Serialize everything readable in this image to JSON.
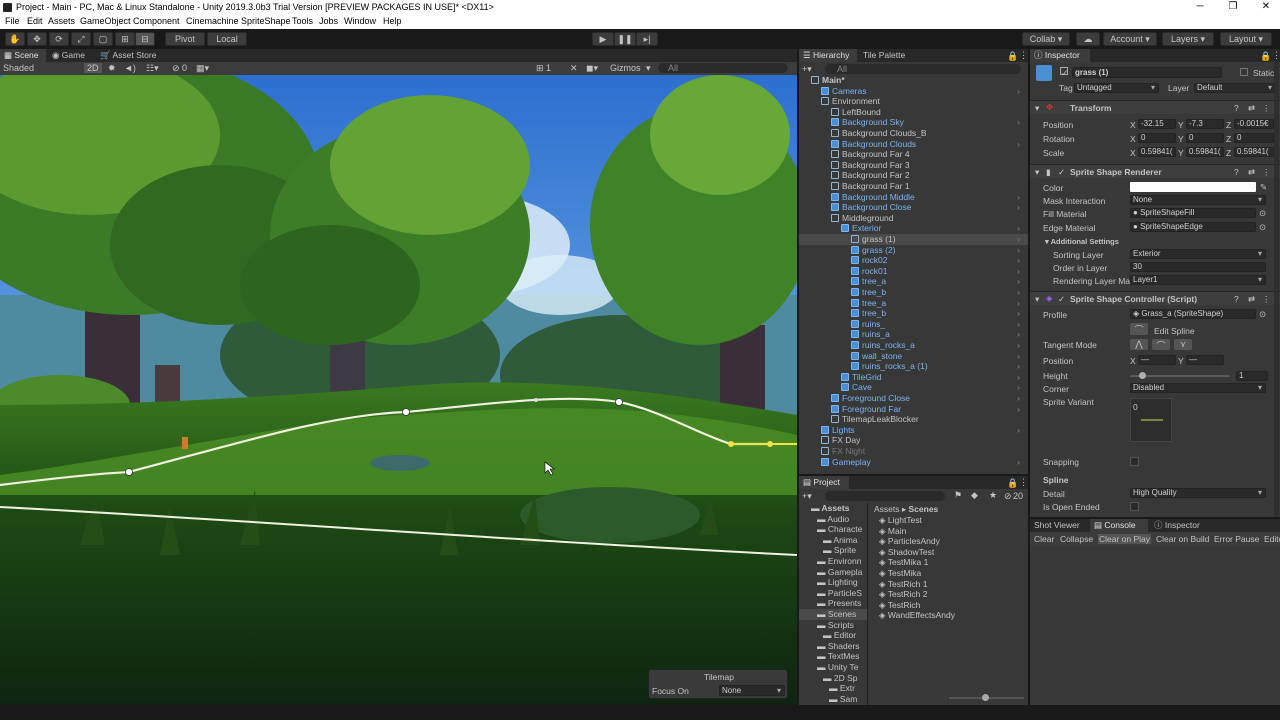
{
  "window": {
    "title": "Project - Main - PC, Mac & Linux Standalone - Unity 2019.3.0b3 Trial Version [PREVIEW PACKAGES IN USE]* <DX11>",
    "minimize": "─",
    "maximize": "❐",
    "close": "✕"
  },
  "menu": [
    "File",
    "Edit",
    "Assets",
    "GameObject",
    "Component",
    "Cinemachine",
    "SpriteShape",
    "Tools",
    "Jobs",
    "Window",
    "Help"
  ],
  "toolbar": {
    "pivot": "Pivot",
    "local": "Local",
    "collab": "Collab ▾",
    "account": "Account",
    "layers": "Layers",
    "layout": "Layout"
  },
  "scene_tabs": [
    "Scene",
    "Game",
    "Asset Store"
  ],
  "scene_bar": {
    "shading": "Shaded",
    "mode": "2D",
    "camera_count": "1",
    "gizmos": "Gizmos",
    "search": "All",
    "layers_count": "0"
  },
  "tilemap": {
    "title": "Tilemap",
    "focus_label": "Focus On",
    "focus_value": "None"
  },
  "hierarchy": {
    "tabs": [
      "Hierarchy",
      "Tile Palette"
    ],
    "search": "All",
    "rows": [
      {
        "label": "Main*",
        "indent": 0,
        "icon": "unity-scene-icon",
        "style": "root"
      },
      {
        "label": "Cameras",
        "indent": 1,
        "style": "blue"
      },
      {
        "label": "Environment",
        "indent": 1,
        "style": "normal"
      },
      {
        "label": "LeftBound",
        "indent": 2,
        "style": "normal"
      },
      {
        "label": "Background Sky",
        "indent": 2,
        "style": "blue"
      },
      {
        "label": "Background Clouds_B",
        "indent": 2,
        "style": "normal"
      },
      {
        "label": "Background Clouds",
        "indent": 2,
        "style": "blue"
      },
      {
        "label": "Background Far 4",
        "indent": 2,
        "style": "normal"
      },
      {
        "label": "Background Far 3",
        "indent": 2,
        "style": "normal"
      },
      {
        "label": "Background Far 2",
        "indent": 2,
        "style": "normal"
      },
      {
        "label": "Background Far 1",
        "indent": 2,
        "style": "normal"
      },
      {
        "label": "Background Middle",
        "indent": 2,
        "style": "blue"
      },
      {
        "label": "Background Close",
        "indent": 2,
        "style": "blue"
      },
      {
        "label": "Middleground",
        "indent": 2,
        "style": "normal"
      },
      {
        "label": "Exterior",
        "indent": 3,
        "style": "blue"
      },
      {
        "label": "grass (1)",
        "indent": 4,
        "style": "selected"
      },
      {
        "label": "grass (2)",
        "indent": 4,
        "style": "blue"
      },
      {
        "label": "rock02",
        "indent": 4,
        "style": "blue"
      },
      {
        "label": "rock01",
        "indent": 4,
        "style": "blue"
      },
      {
        "label": "tree_a",
        "indent": 4,
        "style": "blue"
      },
      {
        "label": "tree_b",
        "indent": 4,
        "style": "blue"
      },
      {
        "label": "tree_a",
        "indent": 4,
        "style": "blue"
      },
      {
        "label": "tree_b",
        "indent": 4,
        "style": "blue"
      },
      {
        "label": "ruins_",
        "indent": 4,
        "style": "blue"
      },
      {
        "label": "ruins_a",
        "indent": 4,
        "style": "blue"
      },
      {
        "label": "ruins_rocks_a",
        "indent": 4,
        "style": "blue"
      },
      {
        "label": "wall_stone",
        "indent": 4,
        "style": "blue"
      },
      {
        "label": "ruins_rocks_a (1)",
        "indent": 4,
        "style": "blue"
      },
      {
        "label": "TileGrid",
        "indent": 3,
        "style": "blue"
      },
      {
        "label": "Cave",
        "indent": 3,
        "style": "blue"
      },
      {
        "label": "Foreground Close",
        "indent": 2,
        "style": "blue"
      },
      {
        "label": "Foreground Far",
        "indent": 2,
        "style": "blue"
      },
      {
        "label": "TilemapLeakBlocker",
        "indent": 2,
        "style": "normal"
      },
      {
        "label": "Lights",
        "indent": 1,
        "style": "blue"
      },
      {
        "label": "FX Day",
        "indent": 1,
        "style": "normal"
      },
      {
        "label": "FX Night",
        "indent": 1,
        "style": "gray"
      },
      {
        "label": "Gameplay",
        "indent": 1,
        "style": "blue"
      }
    ]
  },
  "project": {
    "tab": "Project",
    "count": "20",
    "breadcrumb": [
      "Assets",
      "Scenes"
    ],
    "tree": [
      {
        "label": "Assets",
        "indent": 0,
        "bold": true
      },
      {
        "label": "Audio",
        "indent": 1
      },
      {
        "label": "Characte",
        "indent": 1
      },
      {
        "label": "Anima",
        "indent": 2
      },
      {
        "label": "Sprite",
        "indent": 2
      },
      {
        "label": "Environn",
        "indent": 1
      },
      {
        "label": "Gamepla",
        "indent": 1
      },
      {
        "label": "Lighting",
        "indent": 1
      },
      {
        "label": "ParticleS",
        "indent": 1
      },
      {
        "label": "Presents",
        "indent": 1
      },
      {
        "label": "Scenes",
        "indent": 1,
        "selected": true
      },
      {
        "label": "Scripts",
        "indent": 1
      },
      {
        "label": "Editor",
        "indent": 2
      },
      {
        "label": "Shaders",
        "indent": 1
      },
      {
        "label": "TextMes",
        "indent": 1
      },
      {
        "label": "Unity Te",
        "indent": 1
      },
      {
        "label": "2D Sp",
        "indent": 2
      },
      {
        "label": "Extr",
        "indent": 3
      },
      {
        "label": "Sam",
        "indent": 3
      }
    ],
    "files": [
      "LightTest",
      "Main",
      "ParticlesAndy",
      "ShadowTest",
      "TestMika 1",
      "TestMika",
      "TestRich 1",
      "TestRich 2",
      "TestRich",
      "WandEffectsAndy"
    ]
  },
  "inspector": {
    "tab": "Inspector",
    "object_name": "grass (1)",
    "static": "Static",
    "tag_label": "Tag",
    "tag": "Untagged",
    "layer_label": "Layer",
    "layer": "Default",
    "transform": {
      "title": "Transform",
      "position_label": "Position",
      "px": "-32.15",
      "py": "-7.3",
      "pz": "-0.0015€",
      "rotation_label": "Rotation",
      "rx": "0",
      "ry": "0",
      "rz": "0",
      "scale_label": "Scale",
      "sx": "0.59841(",
      "sy": "0.59841(",
      "sz": "0.59841("
    },
    "renderer": {
      "title": "Sprite Shape Renderer",
      "color_label": "Color",
      "mask_label": "Mask Interaction",
      "mask": "None",
      "fill_label": "Fill Material",
      "fill": "SpriteShapeFill",
      "edge_label": "Edge Material",
      "edge": "SpriteShapeEdge",
      "additional": "Additional Settings",
      "sorting_label": "Sorting Layer",
      "sorting": "Exterior",
      "order_label": "Order in Layer",
      "order": "30",
      "rendering_label": "Rendering Layer Ma",
      "rendering": "Layer1"
    },
    "controller": {
      "title": "Sprite Shape Controller (Script)",
      "profile_label": "Profile",
      "profile": "Grass_a (SpriteShape)",
      "edit_spline": "Edit Spline",
      "tangent_label": "Tangent Mode",
      "position_label": "Position",
      "pos_x": "—",
      "pos_y": "—",
      "height_label": "Height",
      "height": "1",
      "height_fraction": 0.12,
      "corner_label": "Corner",
      "corner": "Disabled",
      "variant_label": "Sprite Variant",
      "variant_index": "0",
      "snapping_label": "Snapping",
      "spline_label": "Spline",
      "detail_label": "Detail",
      "detail": "High Quality",
      "open_label": "Is Open Ended"
    }
  },
  "console": {
    "tabs": [
      "Shot Viewer",
      "Console",
      "Inspector"
    ],
    "buttons": [
      "Clear",
      "Collapse",
      "Clear on Play",
      "Clear on Build",
      "Error Pause",
      "Edito"
    ]
  },
  "colors": {
    "sky": "#5b9be0",
    "grass": "#3f7d22",
    "accent": "#3a72b0"
  }
}
